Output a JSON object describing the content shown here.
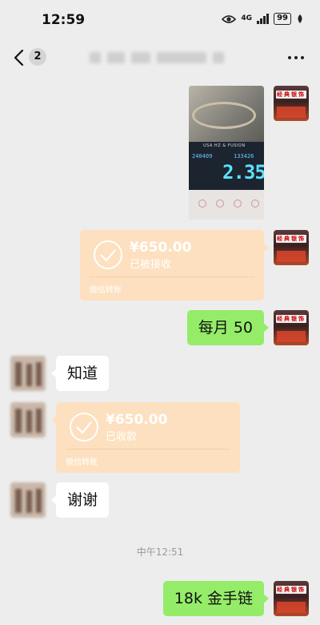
{
  "status_bar": {
    "time": "12:59",
    "network": "4G",
    "battery": "99"
  },
  "header": {
    "unread_count": "2"
  },
  "photo": {
    "brand_text": "USA HZ & FUSION",
    "reading_left": "240409",
    "reading_right": "133426",
    "weight": "2.35"
  },
  "messages": {
    "transfer_sent": {
      "amount": "¥650.00",
      "status": "已被接收",
      "caption": "微信转账"
    },
    "monthly_text": "每月 50",
    "reply_know": "知道",
    "transfer_received": {
      "amount": "¥650.00",
      "status": "已收款",
      "caption": "微信转账"
    },
    "reply_thanks": "谢谢",
    "timestamp": "中午12:51",
    "last_text": "18k 金手链"
  },
  "avatar_self_sign": "经典银饰",
  "colors": {
    "background": "#ededed",
    "green_bubble": "#95ec69",
    "transfer_card": "#fde0bf"
  }
}
